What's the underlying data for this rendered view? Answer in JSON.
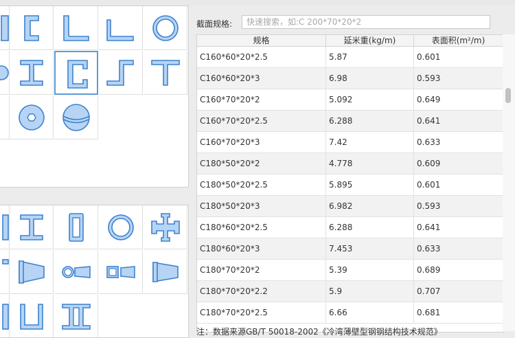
{
  "search": {
    "label": "截面规格:",
    "placeholder": "快速搜索，如:C 200*70*20*2"
  },
  "table": {
    "headers": [
      "规格",
      "延米重(kg/m)",
      "表面积(m²/m)"
    ],
    "rows": [
      [
        "C160*60*20*2.5",
        "5.87",
        "0.601"
      ],
      [
        "C160*60*20*3",
        "6.98",
        "0.593"
      ],
      [
        "C160*70*20*2",
        "5.092",
        "0.649"
      ],
      [
        "C160*70*20*2.5",
        "6.288",
        "0.641"
      ],
      [
        "C160*70*20*3",
        "7.42",
        "0.633"
      ],
      [
        "C180*50*20*2",
        "4.778",
        "0.609"
      ],
      [
        "C180*50*20*2.5",
        "5.895",
        "0.601"
      ],
      [
        "C180*50*20*3",
        "6.982",
        "0.593"
      ],
      [
        "C180*60*20*2.5",
        "6.288",
        "0.641"
      ],
      [
        "C180*60*20*3",
        "7.453",
        "0.633"
      ],
      [
        "C180*70*20*2",
        "5.39",
        "0.689"
      ],
      [
        "C180*70*20*2.2",
        "5.9",
        "0.707"
      ],
      [
        "C180*70*20*2.5",
        "6.66",
        "0.681"
      ]
    ]
  },
  "footnote": "注：数据来源GB/T 50018-2002《冷湾薄壁型钢钢结构技术规范》",
  "palettes": {
    "top": [
      "partial-icon",
      "c-channel-icon",
      "angle-icon",
      "unequal-angle-icon",
      "ring-icon",
      "partial-circle-icon",
      "i-beam-icon",
      "c-lipped-icon",
      "z-section-icon",
      "t-section-icon",
      "partial-icon",
      "hex-bolt-icon",
      "sphere-icon"
    ],
    "bottom": [
      "partial-icon",
      "i-beam-icon",
      "rectangular-tube-icon",
      "ring-icon",
      "cross-section-icon",
      "partial-icon",
      "tapered-i-icon",
      "tapered-tube-icon",
      "tapered-box-icon",
      "tapered-channel-icon",
      "partial-icon",
      "u-channel-icon",
      "double-channel-icon"
    ],
    "selected": "c-lipped-icon"
  },
  "colors": {
    "shape_fill": "#b7d4f4",
    "shape_stroke": "#3c82cf",
    "selected_border": "#5b9bd5",
    "row_alt": "#f2f2f2"
  }
}
